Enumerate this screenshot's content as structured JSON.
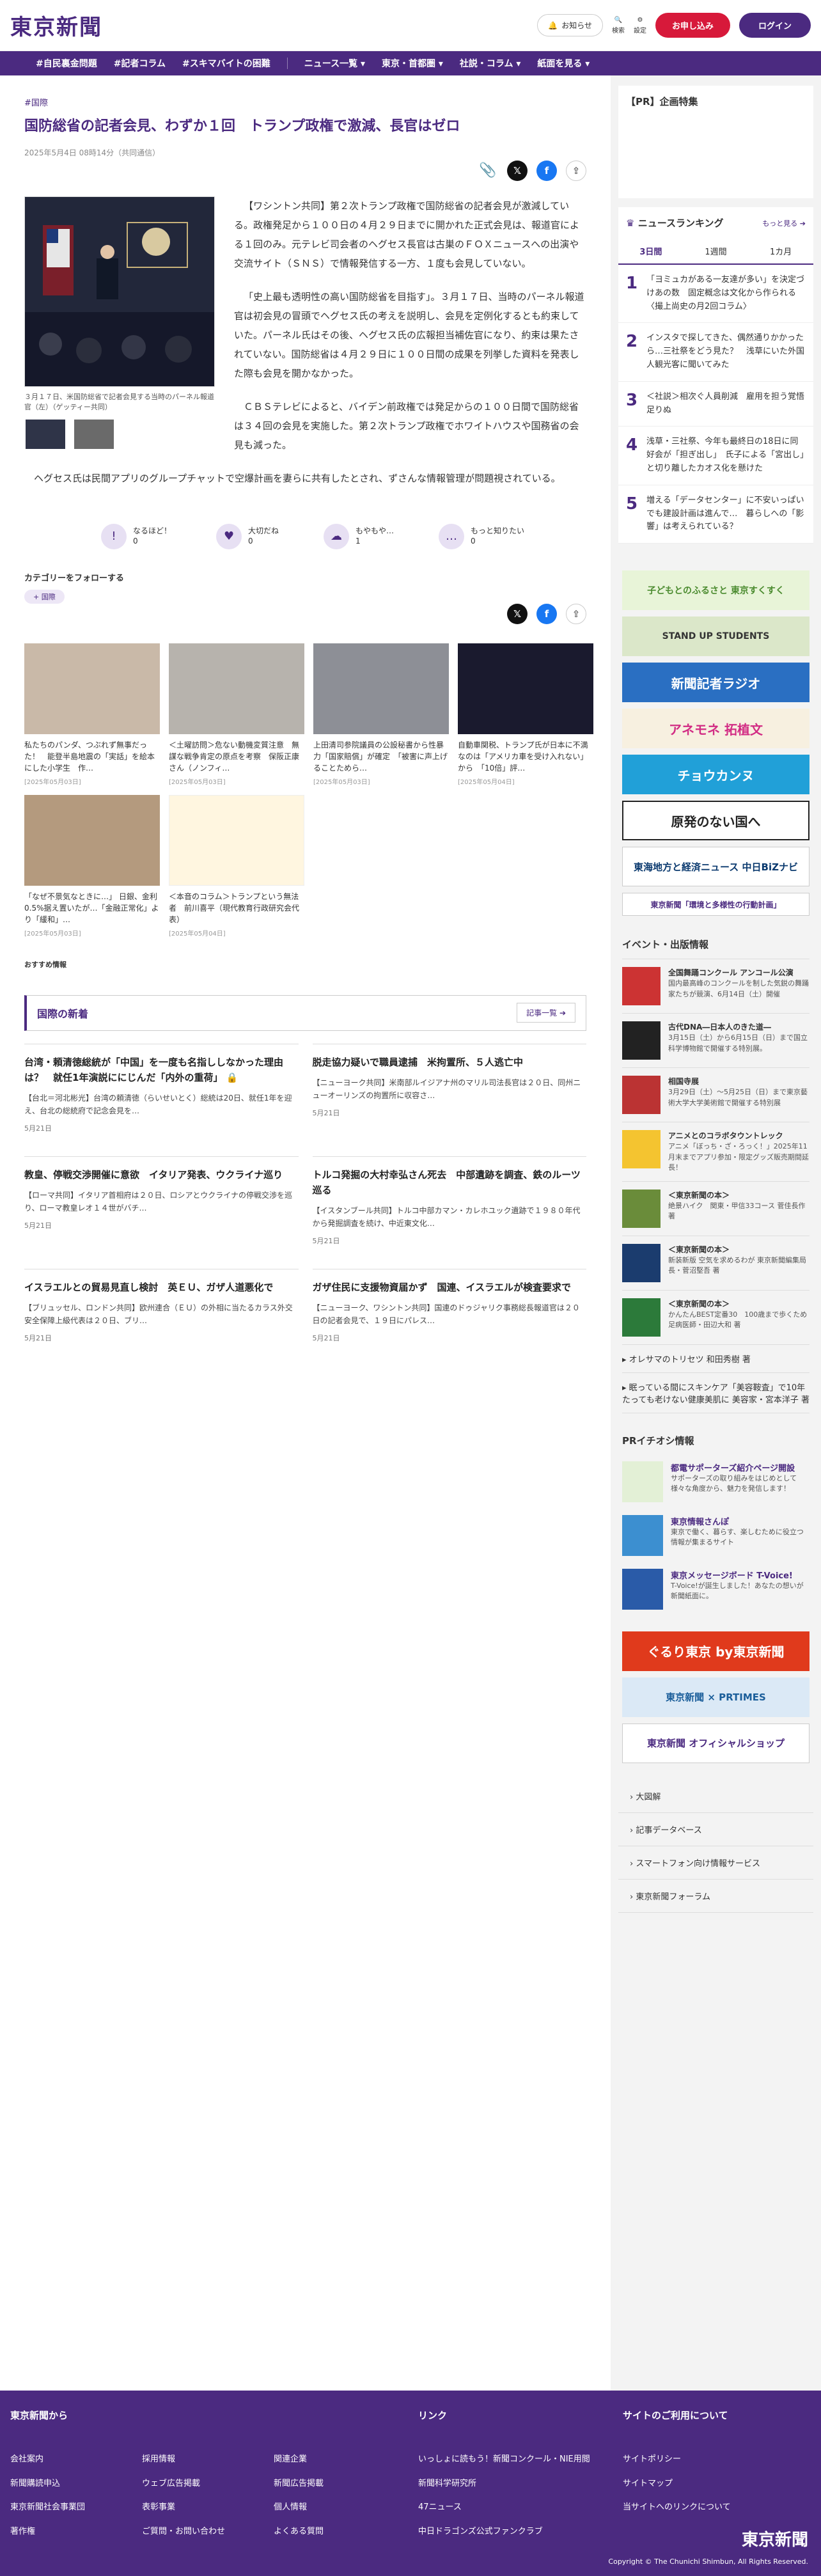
{
  "header": {
    "logo": "東京新聞",
    "notice": "お知らせ",
    "search": "検索",
    "settings": "設定",
    "subscribe": "お申し込み",
    "login": "ログイン"
  },
  "nav": [
    "#自民裏金問題",
    "#記者コラム",
    "#スキマバイトの困難",
    "ニュース一覧 ▾",
    "東京・首都圏 ▾",
    "社説・コラム ▾",
    "紙面を見る ▾"
  ],
  "article": {
    "crumb": "#国際",
    "title": "国防総省の記者会見、わずか１回　トランプ政権で激減、長官はゼロ",
    "date": "2025年5月4日 08時14分（共同通信）",
    "caption": "３月１７日、米国防総省で記者会見する当時のパーネル報道官（左）（ゲッティー共同）",
    "paragraphs": [
      "【ワシントン共同】第２次トランプ政権で国防総省の記者会見が激減している。政権発足から１００日の４月２９日までに開かれた正式会見は、報道官による１回のみ。元テレビ司会者のヘグセス長官は古巣のＦＯＸニュースへの出演や交流サイト（ＳＮＳ）で情報発信する一方、１度も会見していない。",
      "「史上最も透明性の高い国防総省を目指す」。３月１７日、当時のパーネル報道官は初会見の冒頭でヘグセス氏の考えを説明し、会見を定例化するとも約束していた。パーネル氏はその後、ヘグセス氏の広報担当補佐官になり、約束は果たされていない。国防総省は４月２９日に１００日間の成果を列挙した資料を発表した際も会見を開かなかった。",
      "ＣＢＳテレビによると、バイデン前政権では発足からの１００日間で国防総省は３４回の会見を実施した。第２次トランプ政権でホワイトハウスや国務省の会見も減った。",
      "ヘグセス氏は民間アプリのグループチャットで空爆計画を妻らに共有したとされ、ずさんな情報管理が問題視されている。"
    ]
  },
  "reactions": [
    {
      "label": "なるほど！",
      "count": "0",
      "icon": "lightbulb-icon"
    },
    {
      "label": "大切だね",
      "count": "0",
      "icon": "heart-icon"
    },
    {
      "label": "もやもや…",
      "count": "1",
      "icon": "cloud-icon"
    },
    {
      "label": "もっと知りたい",
      "count": "0",
      "icon": "chat-icon"
    }
  ],
  "follow": {
    "label": "カテゴリーをフォローする",
    "tag": "国際"
  },
  "related": [
    {
      "title": "私たちのパンダ、つぶれず無事だった！　能登半島地震の「実話」を絵本にした小学生　作…",
      "date": "[2025年05月03日]",
      "color": "#c9b9a8"
    },
    {
      "title": "＜土曜訪問＞危ない動機変質注意　無謀な戦争肯定の原点を考察　保阪正康さん（ノンフィ…",
      "date": "[2025年05月03日]",
      "color": "#b7b3ad"
    },
    {
      "title": "上田清司参院議員の公設秘書から性暴力「国家賠償」が確定　「被害に声上げることためら…",
      "date": "[2025年05月03日]",
      "color": "#8d8f96"
    },
    {
      "title": "自動車関税、トランプ氏が日本に不満なのは「アメリカ車を受け入れない」から　「10倍」評…",
      "date": "[2025年05月04日]",
      "color": "#1a1a2e"
    },
    {
      "title": "「なぜ不景気なときに…」 日銀、金利0.5%据え置いたが…「金融正常化」より「緩和」…",
      "date": "[2025年05月03日]",
      "color": "#b49a7e"
    },
    {
      "title": "＜本音のコラム＞トランプという無法者　前川喜平（現代教育行政研究会代表）",
      "date": "[2025年05月04日]",
      "color": "#fff6e0"
    }
  ],
  "recommend": "おすすめ情報",
  "intl": {
    "heading": "国際の新着",
    "more": "記事一覧",
    "items": [
      {
        "title": "台湾・頼清徳総統が「中国」を一度も名指ししなかった理由は？　就任1年演説ににじんだ「内外の重荷」",
        "body": "【台北＝河北彬光】台湾の頼清徳（らいせいとく）総統は20日、就任1年を迎え、台北の総統府で記念会見を…",
        "date": "5月21日",
        "lock": true
      },
      {
        "title": "脱走協力疑いで職員逮捕　米拘置所、５人逃亡中",
        "body": "【ニューヨーク共同】米南部ルイジアナ州のマリル司法長官は２０日、同州ニューオーリンズの拘置所に収容さ…",
        "date": "5月21日",
        "lock": false
      },
      {
        "title": "教皇、停戦交渉開催に意欲　イタリア発表、ウクライナ巡り",
        "body": "【ローマ共同】イタリア首相府は２０日、ロシアとウクライナの停戦交渉を巡り、ローマ教皇レオ１４世がバチ…",
        "date": "5月21日",
        "lock": false
      },
      {
        "title": "トルコ発掘の大村幸弘さん死去　中部遺跡を調査、鉄のルーツ巡る",
        "body": "【イスタンブール共同】トルコ中部カマン・カレホユック遺跡で１９８０年代から発掘調査を続け、中近東文化…",
        "date": "5月21日",
        "lock": false
      },
      {
        "title": "イスラエルとの貿易見直し検討　英ＥＵ、ガザ人道悪化で",
        "body": "【ブリュッセル、ロンドン共同】欧州連合（ＥＵ）の外相に当たるカラス外交安全保障上級代表は２０日、ブリ…",
        "date": "5月21日",
        "lock": false
      },
      {
        "title": "ガザ住民に支援物資届かず　国連、イスラエルが検査要求で",
        "body": "【ニューヨーク、ワシントン共同】国連のドゥジャリク事務総長報道官は２０日の記者会見で、１９日にパレス…",
        "date": "5月21日",
        "lock": false
      }
    ]
  },
  "sidebar": {
    "pr_title": "【PR】企画特集",
    "ranking": {
      "title": "ニュースランキング",
      "more": "もっと見る",
      "tabs": [
        "3日間",
        "1週間",
        "1カ月"
      ],
      "items": [
        "「ヨミュカがある一友達が多い」を決定づけあの数　固定概念は文化から作られる〈撮上尚史の月2回コラム〉",
        "インスタで探してきた、偶然通りかかったら…三社祭をどう見た？　浅草にいた外国人観光客に聞いてみた",
        "＜社説＞相次ぐ人員削減　雇用を担う覚悟足りぬ",
        "浅草・三社祭、今年も最終日の18日に同好会が「担ぎ出し」　氏子による「宮出し」と切り離したカオス化を懸けた",
        "増える「データセンター」に不安いっぱいでも建設計画は進んで…　暮らしへの「影響」は考えられている？"
      ]
    },
    "banners": [
      {
        "label": "子どもとのふるさと 東京すくすく",
        "color": "#e8f4d8",
        "fg": "#4b8b2f"
      },
      {
        "label": "STAND UP STUDENTS",
        "color": "#dbe7c9",
        "fg": "#333"
      },
      {
        "label": "新聞記者ラジオ",
        "color": "#2a6fc2",
        "fg": "#fff"
      },
      {
        "label": "アネモネ 拓植文",
        "color": "#f7f0e0",
        "fg": "#d22c84"
      },
      {
        "label": "チョウカンヌ",
        "color": "#21a0d8",
        "fg": "#fff"
      },
      {
        "label": "原発のない国へ",
        "color": "#ffffff",
        "fg": "#222"
      },
      {
        "label": "東海地方と経済ニュース 中日BiZナビ",
        "color": "#ffffff",
        "fg": "#0b3a6f"
      },
      {
        "label": "東京新聞「環境と多様性の行動計画」",
        "color": "#ffffff",
        "fg": "#4b2a80"
      }
    ],
    "events_title": "イベント・出版情報",
    "events": [
      {
        "title": "全国舞踊コンクール アンコール公演",
        "body": "国内最高峰のコンクールを制した気鋭の舞踊家たちが競演、6月14日（土）開催",
        "color": "#c33"
      },
      {
        "title": "古代DNA―日本人のきた道―",
        "body": "3月15日（土）から6月15日（日）まで国立科学博物館で開催する特別展。",
        "color": "#222"
      },
      {
        "title": "相国寺展",
        "body": "3月29日（土）～5月25日（日）まで東京藝術大学大学美術館で開催する特別展",
        "color": "#b33"
      },
      {
        "title": "アニメとのコラボタウントレック",
        "body": "アニメ「ぼっち・ざ・ろっく！」2025年11月末までアプリ参加・限定グッズ販売期間延長！",
        "color": "#f4c430"
      },
      {
        "title": "＜東京新聞の本＞",
        "body": "絶景ハイク　関東・甲信33コース 菅佳長作 著",
        "color": "#6a8c3a"
      },
      {
        "title": "＜東京新聞の本＞",
        "body": "新装新版 空気を求めるわが 東京新聞編集局長・菅沼堅吾 著",
        "color": "#1b3c6e"
      },
      {
        "title": "＜東京新聞の本＞",
        "body": "かんたんBEST定番30　100歳まで歩くため　足病医師・田辺大和 著",
        "color": "#2c7a3a"
      }
    ],
    "ev_links": [
      "オレサマのトリセツ 和田秀樹 著",
      "眠っている間にスキンケア「美容鞍査」で10年たっても老けない健康美肌に 美容家・宮本洋子 著"
    ],
    "pr_info_title": "PRイチオシ情報",
    "pr_info": [
      {
        "title": "都電サポーターズ紹介ページ開設",
        "body": "サポーターズの取り組みをはじめとして様々な角度から、魅力を発信します！",
        "color": "#e3f0d6"
      },
      {
        "title": "東京情報さんぽ",
        "body": "東京で働く、暮らす、楽しむために役立つ情報が集まるサイト",
        "color": "#3c8fd0"
      },
      {
        "title": "東京メッセージボード T-Voice!",
        "body": "T-Voice!が誕生しました！あなたの想いが新聞紙面に。",
        "color": "#2a5ba8"
      }
    ],
    "banners2": [
      {
        "label": "ぐるり東京 by東京新聞",
        "color": "#e03a1c",
        "fg": "#fff"
      },
      {
        "label": "東京新聞 × PRTIMES",
        "color": "#dbe9f6",
        "fg": "#1b5e9a"
      },
      {
        "label": "東京新聞 オフィシャルショップ",
        "color": "#ffffff",
        "fg": "#4b2a80"
      }
    ],
    "links": [
      "大図解",
      "記事データベース",
      "スマートフォン向け情報サービス",
      "東京新聞フォーラム"
    ]
  },
  "footer": {
    "col1_title": "東京新聞から",
    "col2_title": "リンク",
    "col3_title": "サイトのご利用について",
    "col1a": [
      "会社案内",
      "新聞購読申込",
      "東京新聞社会事業団",
      "著作権"
    ],
    "col1b": [
      "採用情報",
      "ウェブ広告掲載",
      "表彰事業",
      "ご質問・お問い合わせ"
    ],
    "col1c": [
      "関連企業",
      "新聞広告掲載",
      "個人情報",
      "よくある質問"
    ],
    "col2": [
      "いっしょに読もう！新聞コンクール・NIE用閲",
      "新聞科学研究所",
      "47ニュース",
      "中日ドラゴンズ公式ファンクラブ"
    ],
    "col3": [
      "サイトポリシー",
      "サイトマップ",
      "当サイトへのリンクについて"
    ],
    "logo": "東京新聞",
    "copyright": "Copyright © The Chunichi Shimbun, All Rights Reserved."
  }
}
